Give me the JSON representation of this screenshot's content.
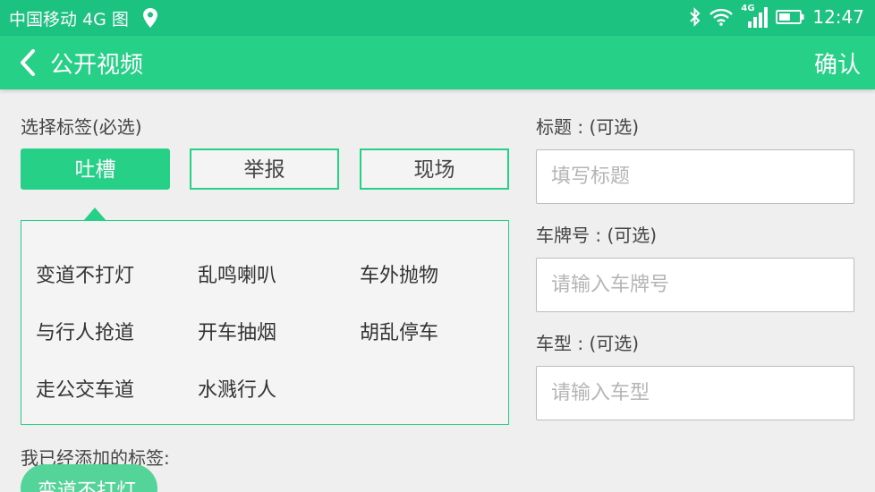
{
  "status_bar": {
    "carrier": "中国移动 4G 图",
    "network_badge": "4G",
    "time": "12:47"
  },
  "header": {
    "title": "公开视频",
    "confirm_label": "确认"
  },
  "tags": {
    "section_label": "选择标签(必选)",
    "categories": [
      "吐槽",
      "举报",
      "现场"
    ],
    "selected_category": "吐槽",
    "sub_tags": [
      "变道不打灯",
      "乱鸣喇叭",
      "车外抛物",
      "与行人抢道",
      "开车抽烟",
      "胡乱停车",
      "走公交车道",
      "水溅行人"
    ],
    "added_label": "我已经添加的标签:",
    "added": [
      "变道不打灯"
    ]
  },
  "form": {
    "title_label": "标题 : (可选)",
    "title_placeholder": "填写标题",
    "title_value": "",
    "plate_label": "车牌号 : (可选)",
    "plate_placeholder": "请输入车牌号",
    "plate_value": "",
    "model_label": "车型 : (可选)",
    "model_placeholder": "请输入车型",
    "model_value": ""
  },
  "colors": {
    "status_bar": "#1cc280",
    "header": "#26d086",
    "accent": "#26d086",
    "chip": "#55d49a",
    "background": "#efefef"
  }
}
